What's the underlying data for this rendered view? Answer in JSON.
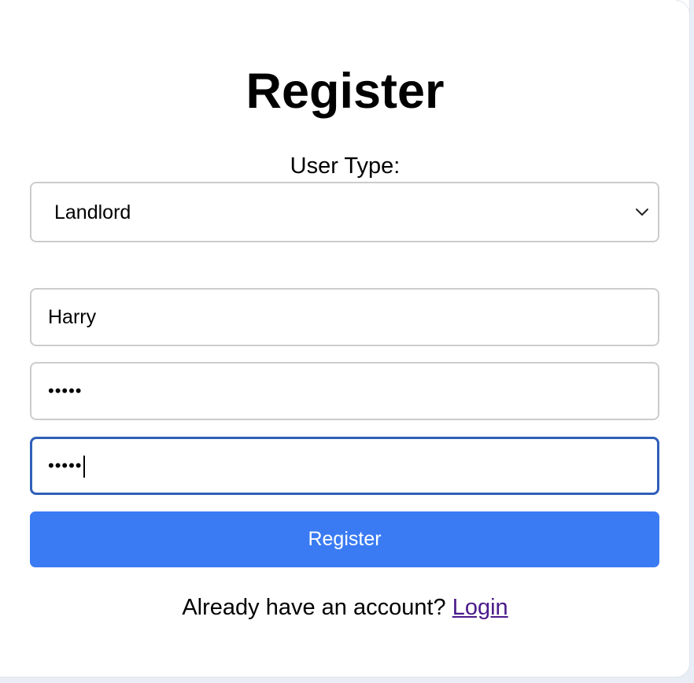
{
  "form": {
    "title": "Register",
    "user_type_label": "User Type:",
    "user_type_selected": "Landlord",
    "username_value": "Harry",
    "password_value": "•••••",
    "confirm_password_value": "•••••",
    "submit_label": "Register",
    "footer_text": "Already have an account?",
    "login_link_label": "Login"
  },
  "colors": {
    "accent": "#3a7bf3",
    "focus_border": "#2f5fb8",
    "link": "#4a1a8a"
  },
  "icons": {
    "select_chevron": "chevron-down-icon"
  }
}
